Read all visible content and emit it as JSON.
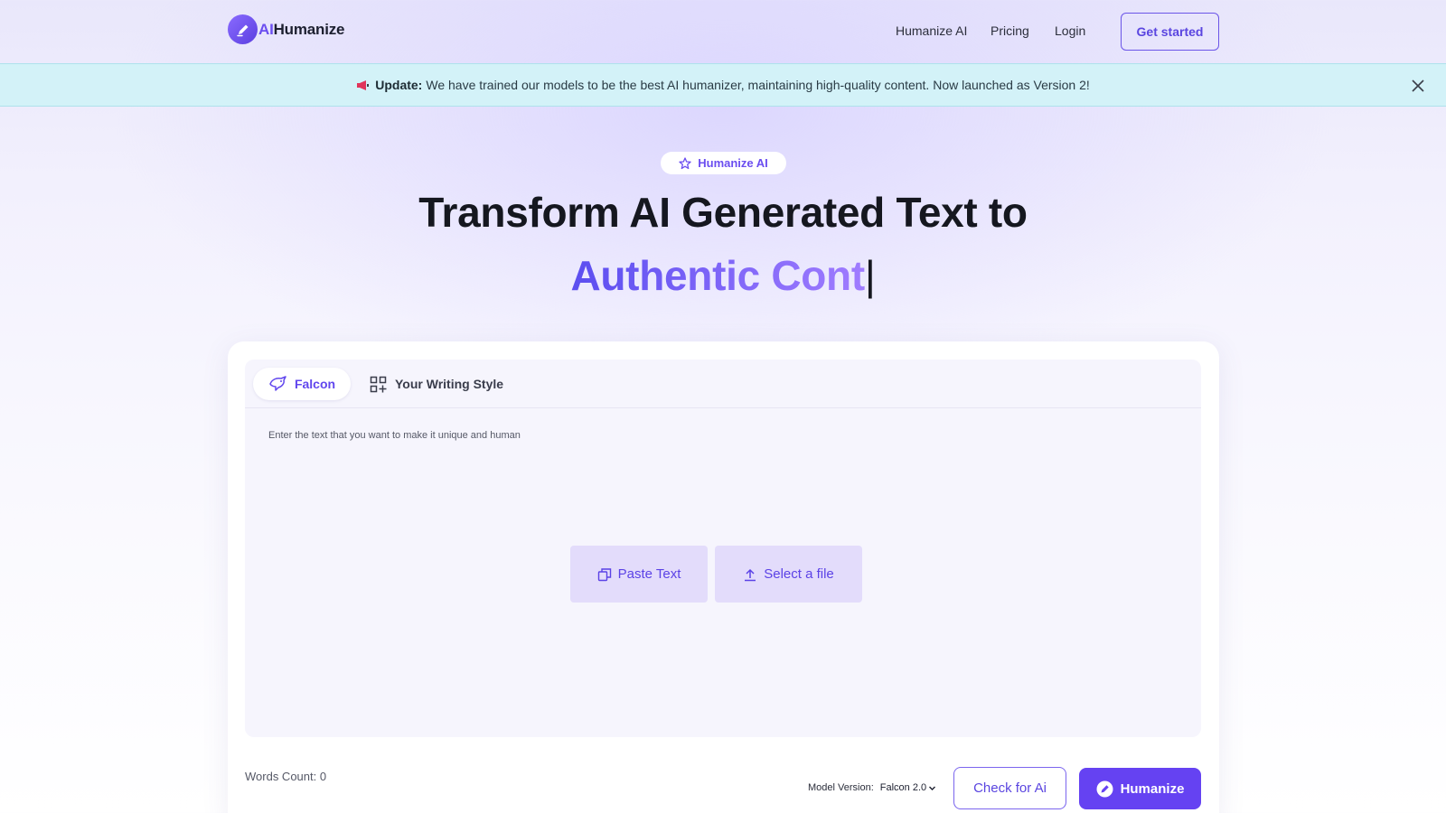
{
  "brand": {
    "name_ai": "AI",
    "name_rest": "Humanize",
    "accent": "#6b4ef0"
  },
  "nav": {
    "items": [
      {
        "label": "Humanize AI"
      },
      {
        "label": "Pricing"
      },
      {
        "label": "Login"
      }
    ],
    "cta_label": "Get started"
  },
  "banner": {
    "icon": "megaphone-icon",
    "strong": "Update:",
    "message": "We have trained our models to be the best AI humanizer, maintaining high-quality content. Now launched as Version 2!",
    "background": "#d3f2f8"
  },
  "hero": {
    "chip_label": "Humanize AI",
    "title": "Transform AI Generated Text to",
    "subtitle": "Authentic Cont",
    "caret": "|"
  },
  "editor": {
    "tabs": [
      {
        "label": "Falcon",
        "icon": "falcon-icon",
        "active": true
      },
      {
        "label": "Your Writing Style",
        "icon": "grid-plus-icon",
        "active": false
      }
    ],
    "placeholder": "Enter the text that you want to make it unique and human",
    "paste_label": "Paste Text",
    "file_label": "Select a file"
  },
  "footer": {
    "words_count": "Words Count: 0",
    "model_version_label": "Model Version:",
    "model_version_value": "Falcon 2.0",
    "check_label": "Check for Ai",
    "humanize_label": "Humanize",
    "primary_color": "#6542f2"
  }
}
